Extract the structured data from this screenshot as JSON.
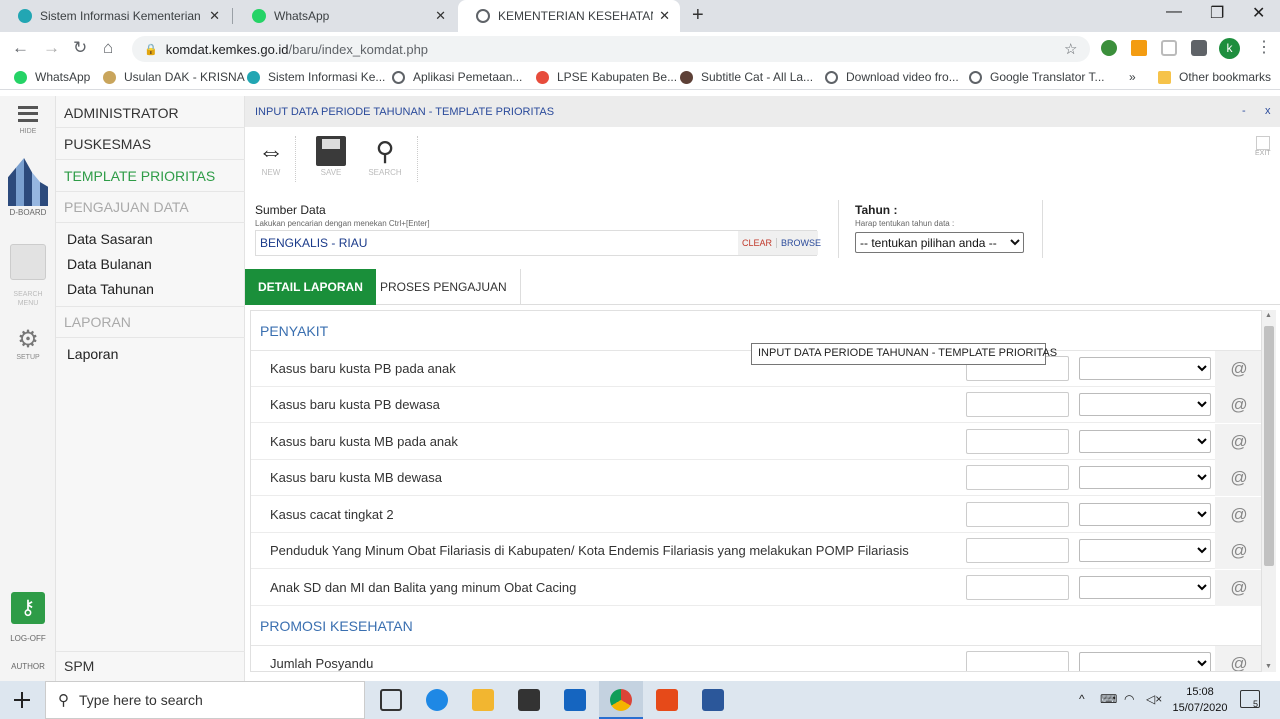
{
  "browser": {
    "tabs": [
      {
        "title": "Sistem Informasi Kementerian Ke",
        "icon": "kemenkes-icon",
        "color": "#22a6b3"
      },
      {
        "title": "WhatsApp",
        "icon": "whatsapp-icon",
        "color": "#25d366"
      },
      {
        "title": "KEMENTERIAN KESEHATAN REPU",
        "icon": "globe-icon",
        "color": "#5f6368"
      }
    ],
    "new_tab": "+",
    "url_domain": "komdat.kemkes.go.id",
    "url_path": "/baru/index_komdat.php",
    "profile_initial": "k",
    "bookmarks": [
      "WhatsApp",
      "Usulan DAK - KRISNA",
      "Sistem Informasi Ke...",
      "Aplikasi Pemetaan...",
      "LPSE Kabupaten Be...",
      "Subtitle Cat - All La...",
      "Download video fro...",
      "Google Translator T..."
    ],
    "bookmarks_more": "»",
    "other_bookmarks": "Other bookmarks"
  },
  "iconbar": {
    "hide": "HIDE",
    "dboard": "D-BOARD",
    "search_menu": "SEARCH MENU",
    "setup": "SETUP",
    "logoff": "LOG-OFF",
    "author": "AUTHOR"
  },
  "menu": {
    "administrator": "ADMINISTRATOR",
    "puskesmas": "PUSKESMAS",
    "template_prioritas": "TEMPLATE PRIORITAS",
    "pengajuan_data": "PENGAJUAN DATA",
    "data_sasaran": "Data Sasaran",
    "data_bulanan": "Data Bulanan",
    "data_tahunan": "Data Tahunan",
    "laporan_head": "LAPORAN",
    "laporan": "Laporan",
    "spm": "SPM"
  },
  "main": {
    "title": "INPUT DATA PERIODE TAHUNAN - TEMPLATE PRIORITAS",
    "minimize": "-",
    "close": "x",
    "tools": {
      "new": "NEW",
      "save": "SAVE",
      "search": "SEARCH"
    },
    "exit": "EXIT",
    "sumber_label": "Sumber Data",
    "sumber_hint": "Lakukan pencarian dengan menekan Ctrl+[Enter]",
    "sumber_value": "BENGKALIS - RIAU",
    "clear": "CLEAR",
    "browse": "BROWSE",
    "tahun_label": "Tahun :",
    "tahun_hint": "Harap tentukan tahun data :",
    "tahun_select": "-- tentukan pilihan anda --",
    "tab_detail": "DETAIL LAPORAN",
    "tab_proses": "PROSES PENGAJUAN",
    "section_penyakit": "PENYAKIT",
    "rows": [
      "Kasus baru kusta PB pada anak",
      "Kasus baru kusta PB dewasa",
      "Kasus baru kusta MB pada anak",
      "Kasus baru kusta MB dewasa",
      "Kasus cacat tingkat 2",
      "Penduduk Yang Minum Obat Filariasis di Kabupaten/ Kota Endemis Filariasis yang melakukan POMP Filariasis",
      "Anak SD dan MI dan Balita yang minum Obat Cacing"
    ],
    "section_promosi": "PROMOSI KESEHATAN",
    "row_posyandu": "Jumlah Posyandu",
    "at_symbol": "@",
    "tooltip": "INPUT DATA PERIODE TAHUNAN - TEMPLATE PRIORITAS"
  },
  "taskbar": {
    "search_placeholder": "Type here to search",
    "time": "15:08",
    "date": "15/07/2020",
    "notif_count": "5"
  },
  "colors": {
    "accent_green": "#1a8f3a",
    "link_blue": "#2b4b9b"
  }
}
